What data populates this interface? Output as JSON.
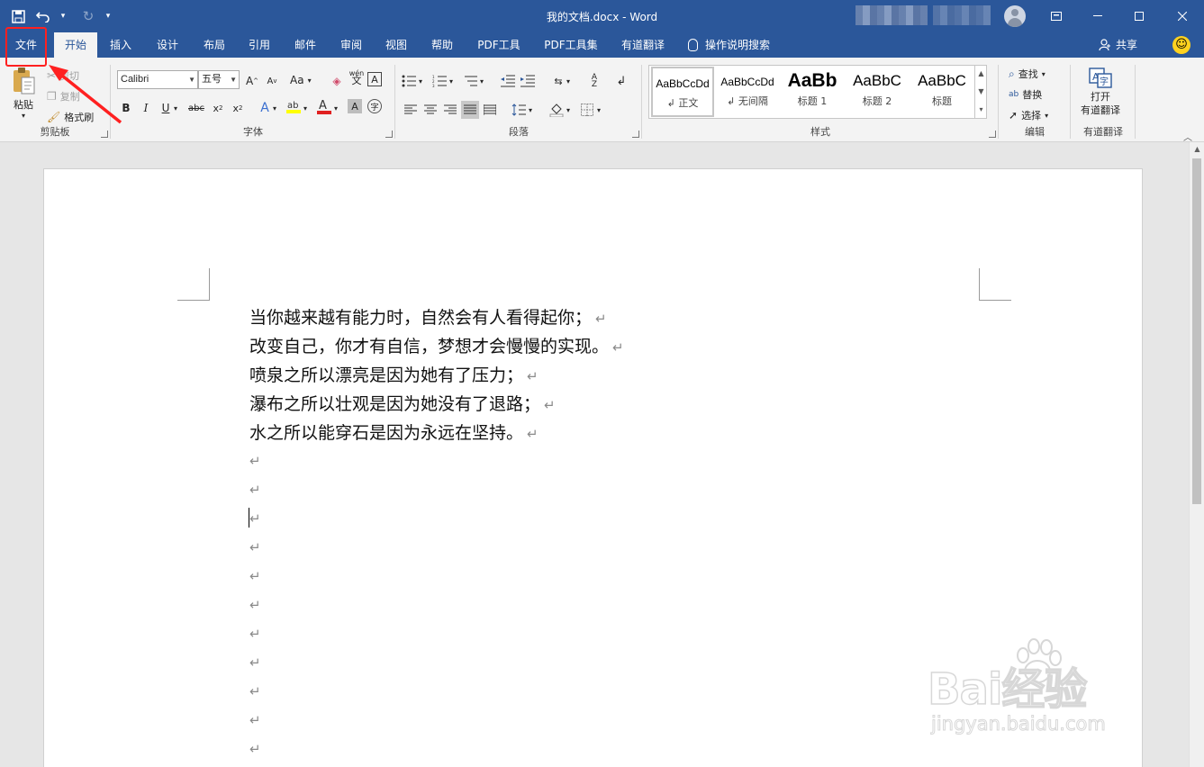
{
  "window": {
    "title": "我的文档.docx  -  Word",
    "qat_more": "▾"
  },
  "tabs": [
    {
      "label": "文件"
    },
    {
      "label": "开始"
    },
    {
      "label": "插入"
    },
    {
      "label": "设计"
    },
    {
      "label": "布局"
    },
    {
      "label": "引用"
    },
    {
      "label": "邮件"
    },
    {
      "label": "审阅"
    },
    {
      "label": "视图"
    },
    {
      "label": "帮助"
    },
    {
      "label": "PDF工具"
    },
    {
      "label": "PDF工具集"
    },
    {
      "label": "有道翻译"
    }
  ],
  "tell_me": "操作说明搜索",
  "share": "共享",
  "clipboard": {
    "paste": "粘贴",
    "cut": "剪切",
    "copy": "复制",
    "format_painter": "格式刷",
    "label": "剪贴板"
  },
  "font": {
    "name": "Calibri",
    "size": "五号",
    "label": "字体",
    "case_btn": "Aa",
    "pinyin": "wén"
  },
  "paragraph": {
    "label": "段落"
  },
  "styles": {
    "label": "样式",
    "items": [
      {
        "preview": "AaBbCcDd",
        "name": "↲ 正文"
      },
      {
        "preview": "AaBbCcDd",
        "name": "↲ 无间隔"
      },
      {
        "preview": "AaBb",
        "name": "标题 1"
      },
      {
        "preview": "AaBbC",
        "name": "标题 2"
      },
      {
        "preview": "AaBbC",
        "name": "标题"
      }
    ]
  },
  "editing": {
    "find": "查找",
    "replace": "替换",
    "select": "选择",
    "label": "编辑"
  },
  "youdao": {
    "open_line1": "打开",
    "open_line2": "有道翻译",
    "label": "有道翻译"
  },
  "document": {
    "lines": [
      "当你越来越有能力时，自然会有人看得起你；",
      "改变自己，你才有自信，梦想才会慢慢的实现。",
      "喷泉之所以漂亮是因为她有了压力；",
      "瀑布之所以壮观是因为她没有了退路；",
      "水之所以能穿石是因为永远在坚持。"
    ],
    "paragraph_mark": "↵"
  },
  "watermark": {
    "brand": "Bai经验",
    "url": "jingyan.baidu.com"
  },
  "colors": {
    "accent": "#2b579a",
    "highlight": "#ff2020"
  }
}
